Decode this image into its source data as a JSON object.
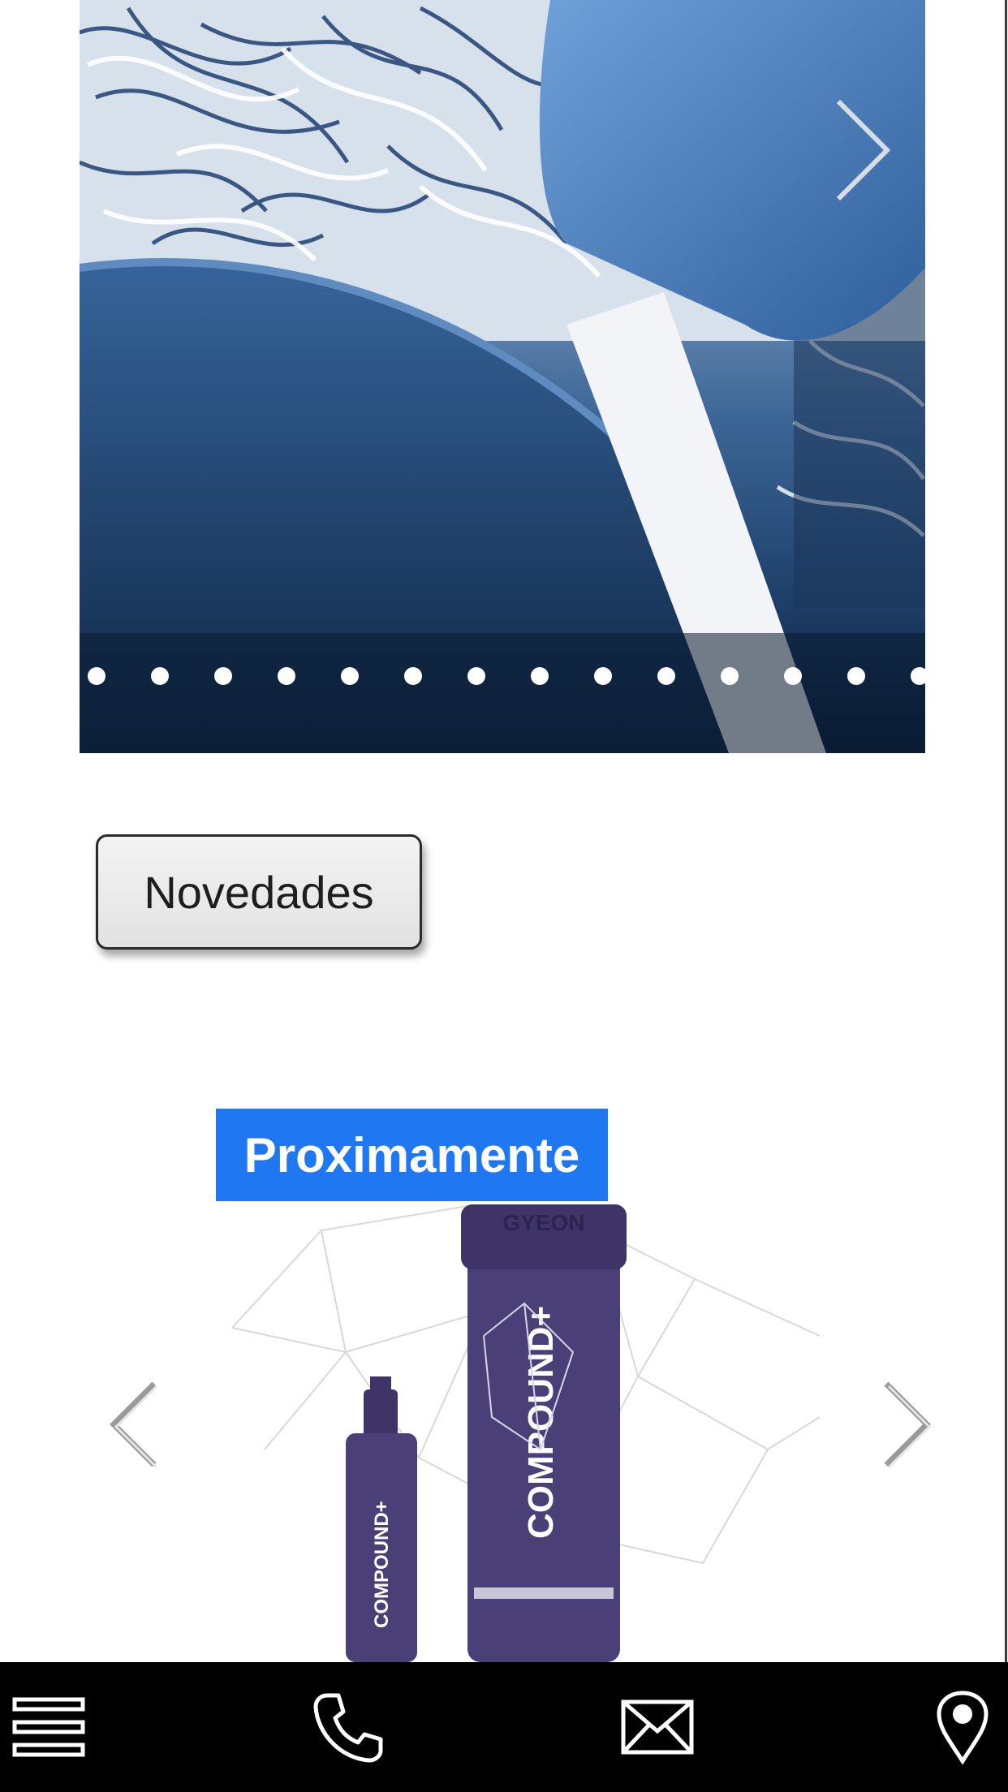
{
  "hero_slider": {
    "dot_count": 14,
    "next_icon": "chevron-right-icon"
  },
  "novedades_button": {
    "label": "Novedades"
  },
  "product_slider": {
    "badge": "Proximamente",
    "product_brand": "GYEON",
    "product_label": "COMPOUND+",
    "prev_icon": "chevron-left-icon",
    "next_icon": "chevron-right-icon",
    "badge_color": "#1f78f2",
    "bottle_color": "#4b3f78"
  },
  "bottom_bar": {
    "background": "#000000",
    "items": [
      {
        "icon": "menu-icon"
      },
      {
        "icon": "phone-icon"
      },
      {
        "icon": "mail-icon"
      },
      {
        "icon": "map-pin-icon"
      }
    ]
  }
}
